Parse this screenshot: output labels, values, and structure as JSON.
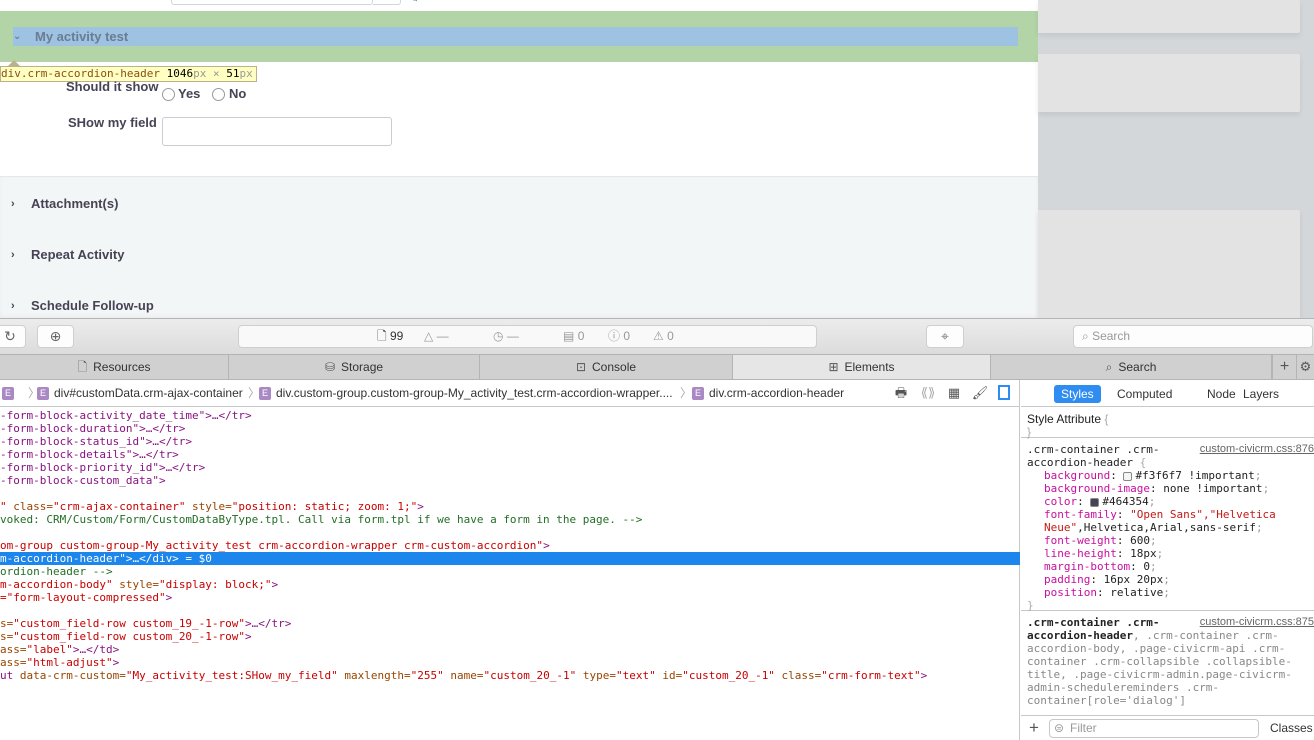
{
  "webpage": {
    "accordion_header": {
      "title": "My activity test",
      "expanded": true,
      "chevron_icon": "chevron-down-icon"
    },
    "inspect_tooltip": {
      "selector": "div.crm-accordion-header",
      "width": "1046",
      "height": "51",
      "unit": "px",
      "times": "×"
    },
    "fields": [
      {
        "label": "Should it show",
        "type": "radio",
        "options": [
          "Yes",
          "No"
        ],
        "selected": null
      },
      {
        "label": "SHow my field",
        "type": "text",
        "value": "",
        "placeholder": ""
      }
    ],
    "sections": [
      {
        "label": "Attachment(s)",
        "expanded": false
      },
      {
        "label": "Repeat Activity",
        "expanded": false
      },
      {
        "label": "Schedule Follow-up",
        "expanded": false
      }
    ],
    "colors": {
      "highlight_margin": "#b3d4a6",
      "highlight_content": "#9ec2e2",
      "text": "#464354",
      "section_bg": "#f3f6f7"
    }
  },
  "devtools": {
    "toolbar": {
      "reload_icon": "reload-icon",
      "download_icon": "download-icon",
      "resources_count": "99",
      "network_size": "—",
      "load_time": "—",
      "logs_count": "0",
      "errors_count": "0",
      "warnings_count": "0",
      "search_placeholder": "Search"
    },
    "tabs": [
      {
        "label": "Resources",
        "icon": "document-icon",
        "active": false
      },
      {
        "label": "Storage",
        "icon": "database-icon",
        "active": false
      },
      {
        "label": "Console",
        "icon": "console-icon",
        "active": false
      },
      {
        "label": "Elements",
        "icon": "elements-icon",
        "active": true
      },
      {
        "label": "Search",
        "icon": "search-icon",
        "active": false
      }
    ],
    "breadcrumb": [
      {
        "label": ""
      },
      {
        "label": "div#customData.crm-ajax-container"
      },
      {
        "label": "div.custom-group.custom-group-My_activity_test.crm-accordion-wrapper...."
      },
      {
        "label": "div.crm-accordion-header"
      }
    ],
    "dom_lines": [
      {
        "parts": [
          [
            "t",
            "-form-block-activity_date_time\">…</tr>"
          ]
        ]
      },
      {
        "parts": [
          [
            "t",
            "-form-block-duration\">…</tr>"
          ]
        ]
      },
      {
        "parts": [
          [
            "t",
            "-form-block-status_id\">…</tr>"
          ]
        ]
      },
      {
        "parts": [
          [
            "t",
            "-form-block-details\">…</tr>"
          ]
        ]
      },
      {
        "parts": [
          [
            "t",
            "-form-block-priority_id\">…</tr>"
          ]
        ]
      },
      {
        "parts": [
          [
            "t",
            "-form-block-custom_data\">"
          ]
        ]
      },
      {
        "parts": []
      },
      {
        "parts": [
          [
            "v",
            "\""
          ],
          [
            "a",
            " class="
          ],
          [
            "v",
            "\"crm-ajax-container\""
          ],
          [
            "a",
            " style="
          ],
          [
            "v",
            "\"position: static; zoom: 1;\""
          ],
          [
            "t",
            ">"
          ]
        ]
      },
      {
        "parts": [
          [
            "c",
            "voked: CRM/Custom/Form/CustomDataByType.tpl. Call via form.tpl if we have a form in the page. -->"
          ]
        ]
      },
      {
        "parts": []
      },
      {
        "parts": [
          [
            "v",
            "om-group custom-group-My_activity_test crm-accordion-wrapper crm-custom-accordion\""
          ],
          [
            "t",
            ">"
          ]
        ]
      },
      {
        "parts": [
          [
            "s",
            "m-accordion-header\">…</div> = $0"
          ]
        ],
        "selected": true
      },
      {
        "parts": [
          [
            "c",
            "ordion-header -->"
          ]
        ]
      },
      {
        "parts": [
          [
            "v",
            "m-accordion-body\""
          ],
          [
            "a",
            " style="
          ],
          [
            "v",
            "\"display: block;\""
          ],
          [
            "t",
            ">"
          ]
        ]
      },
      {
        "parts": [
          [
            "v",
            "=\"form-layout-compressed\""
          ],
          [
            "t",
            ">"
          ]
        ]
      },
      {
        "parts": []
      },
      {
        "parts": [
          [
            "a",
            "s="
          ],
          [
            "v",
            "\"custom_field-row custom_19_-1-row\""
          ],
          [
            "t",
            ">…</tr>"
          ]
        ]
      },
      {
        "parts": [
          [
            "a",
            "s="
          ],
          [
            "v",
            "\"custom_field-row custom_20_-1-row\""
          ],
          [
            "t",
            ">"
          ]
        ]
      },
      {
        "parts": [
          [
            "a",
            "ass="
          ],
          [
            "v",
            "\"label\""
          ],
          [
            "t",
            ">…</td>"
          ]
        ]
      },
      {
        "parts": [
          [
            "a",
            "ass="
          ],
          [
            "v",
            "\"html-adjust\""
          ],
          [
            "t",
            ">"
          ]
        ]
      },
      {
        "parts": [
          [
            "t",
            "ut "
          ],
          [
            "a",
            "data-crm-custom="
          ],
          [
            "v",
            "\"My_activity_test:SHow_my_field\""
          ],
          [
            "a",
            " maxlength="
          ],
          [
            "v",
            "\"255\""
          ],
          [
            "a",
            " name="
          ],
          [
            "v",
            "\"custom_20_-1\""
          ],
          [
            "a",
            " type="
          ],
          [
            "v",
            "\"text\""
          ],
          [
            "a",
            " id="
          ],
          [
            "v",
            "\"custom_20_-1\""
          ],
          [
            "a",
            " class="
          ],
          [
            "v",
            "\"crm-form-text\""
          ],
          [
            "t",
            ">"
          ]
        ]
      }
    ],
    "sidebar_tabs": [
      {
        "label": "Styles",
        "active": true
      },
      {
        "label": "Computed",
        "active": false
      },
      {
        "label": "Node",
        "active": false
      },
      {
        "label": "Layers",
        "active": false
      }
    ],
    "style_attribute": {
      "label": "Style Attribute",
      "open": "{",
      "close": "}"
    },
    "rules": [
      {
        "selector_line1": ".crm-container .crm-",
        "selector_line2": "accordion-header",
        "source": "custom-civicrm.css:876",
        "declarations": [
          {
            "prop": "background",
            "value": "#f3f6f7 !important",
            "swatch": "#f3f6f7"
          },
          {
            "prop": "background-image",
            "value": "none !important"
          },
          {
            "prop": "color",
            "value": "#464354",
            "swatch": "#464354"
          },
          {
            "prop": "font-family",
            "value_str": "\"Open Sans\",\"Helvetica",
            "value_cont_str": "Neue\"",
            "value_cont": ",Helvetica,Arial,sans-serif"
          },
          {
            "prop": "font-weight",
            "value": "600"
          },
          {
            "prop": "line-height",
            "value": "18px"
          },
          {
            "prop": "margin-bottom",
            "value": "0"
          },
          {
            "prop": "padding",
            "value": "16px 20px"
          },
          {
            "prop": "position",
            "value": "relative"
          }
        ]
      },
      {
        "selector_bold": ".crm-container .crm-",
        "selector_bold2": "accordion-header",
        "selector_rest": [
          ", .crm-container .crm-",
          "accordion-body, .page-civicrm-api .crm-",
          "container .crm-collapsible .collapsible-",
          "title, .page-civicrm-admin.page-civicrm-",
          "admin-schedulereminders .crm-",
          "container[role='dialog']"
        ],
        "source": "custom-civicrm.css:875"
      }
    ],
    "filter_placeholder": "Filter",
    "classes_label": "Classes"
  }
}
